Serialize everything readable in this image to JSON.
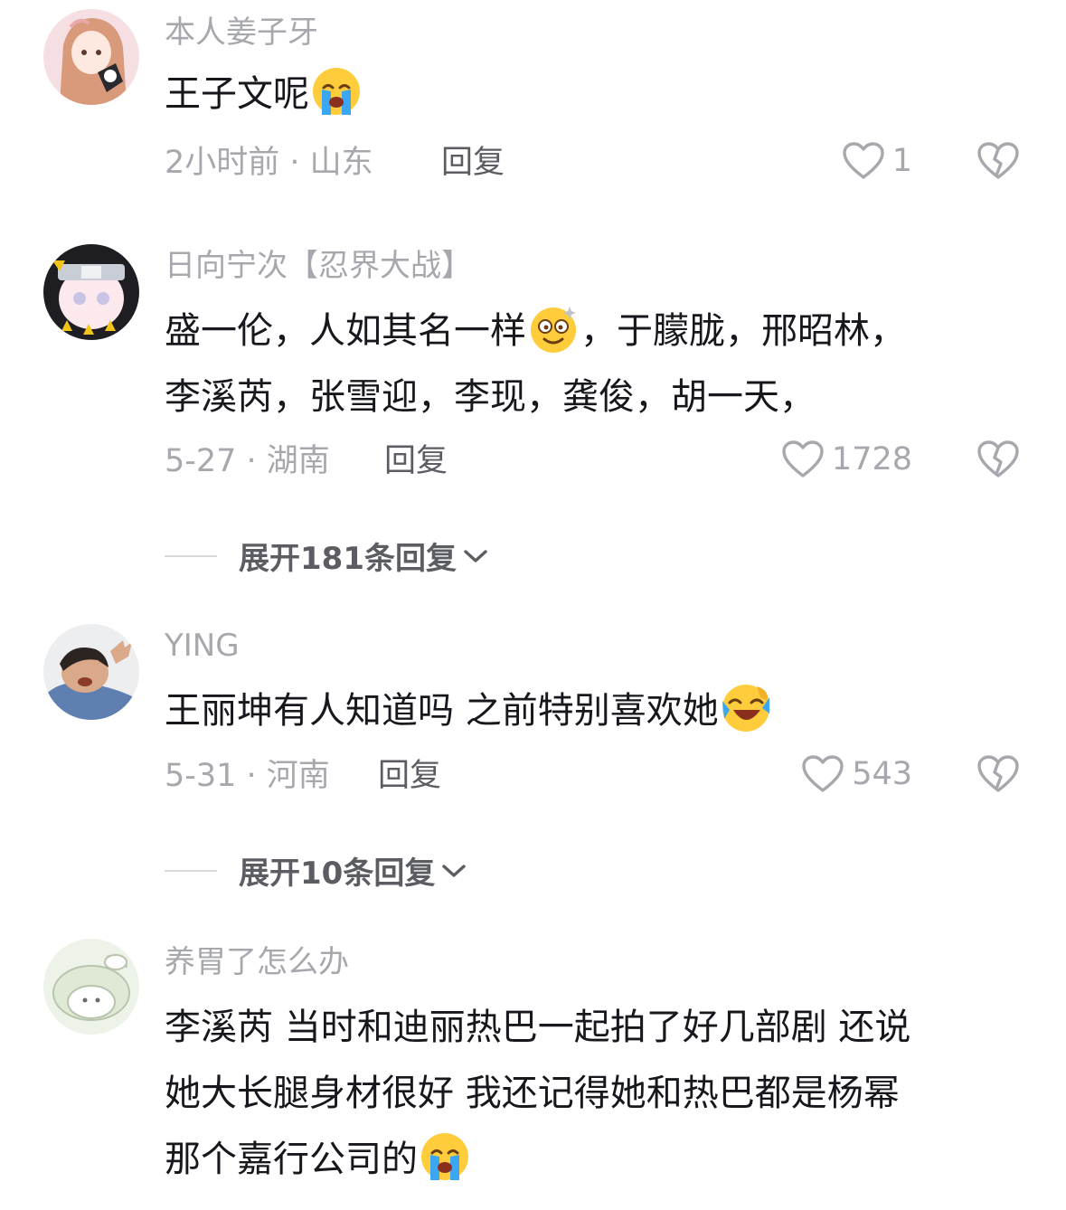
{
  "comments": [
    {
      "username": "本人姜子牙",
      "text_parts": [
        "王子文呢"
      ],
      "emoji": "loudly-crying-face",
      "time_location": "2小时前 · 山东",
      "reply_label": "回复",
      "likes": "1"
    },
    {
      "username": "日向宁次【忍界大战】",
      "text_part1": "盛一伦，人如其名一样",
      "emoji": "dizzy-smiling-face",
      "text_part2": "，于朦胧，邢昭林，",
      "text_line2": "李溪芮，张雪迎，李现，龚俊，胡一天，",
      "time_location": "5-27 · 湖南",
      "reply_label": "回复",
      "likes": "1728",
      "expand_label": "展开181条回复"
    },
    {
      "username": "YING",
      "text_part1": "王丽坤有人知道吗 之前特别喜欢她",
      "emoji": "rolling-laughing-face",
      "time_location": "5-31 · 河南",
      "reply_label": "回复",
      "likes": "543",
      "expand_label": "展开10条回复"
    },
    {
      "username": "养胃了怎么办",
      "text_line1": "李溪芮 当时和迪丽热巴一起拍了好几部剧 还说",
      "text_line2": "她大长腿身材很好 我还记得她和热巴都是杨幂",
      "text_line3": "那个嘉行公司的",
      "emoji": "loudly-crying-face"
    }
  ],
  "colors": {
    "primary_text": "#16181d",
    "secondary_text": "#a7a8ad",
    "reply_text": "#5b5d63",
    "divider": "#d9dadc"
  }
}
